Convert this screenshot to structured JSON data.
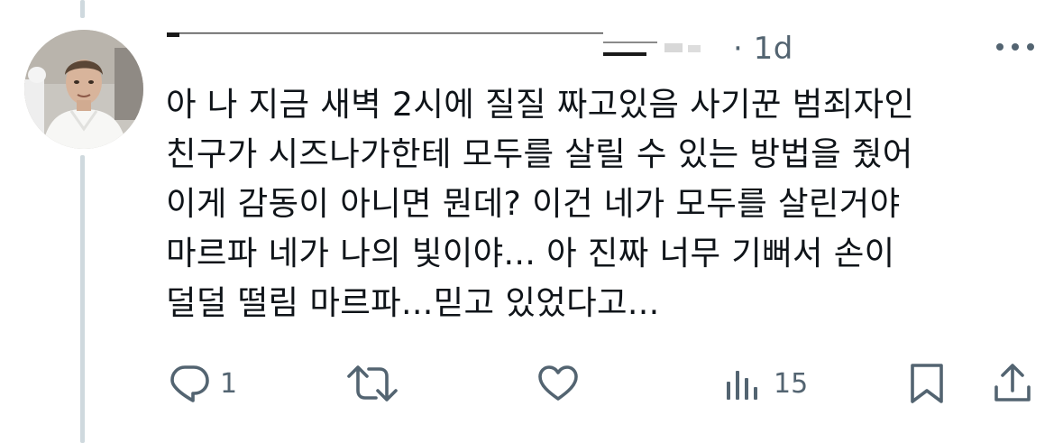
{
  "tweet": {
    "timestamp": "· 1d",
    "text_lines": [
      "아 나 지금 새벽 2시에 질질 짜고있음 사기꾼 범죄자인",
      "친구가 시즈나가한테 모두를 살릴 수 있는 방법을 줬어",
      "이게 감동이 아니면 뭔데? 이건 네가 모두를 살린거야",
      "마르파 네가 나의 빛이야... 아 진짜 너무 기뻐서 손이",
      "덜덜 떨림 마르파...믿고 있었다고..."
    ]
  },
  "actions": {
    "reply_count": "1",
    "retweet_count": "",
    "like_count": "",
    "views_count": "15"
  },
  "colors": {
    "text": "#0f1419",
    "muted": "#536471",
    "thread_line": "#cfd9de"
  },
  "icons": {
    "reply": "reply-icon",
    "retweet": "retweet-icon",
    "like": "heart-icon",
    "views": "views-icon",
    "bookmark": "bookmark-icon",
    "share": "share-icon",
    "more": "more-icon"
  }
}
